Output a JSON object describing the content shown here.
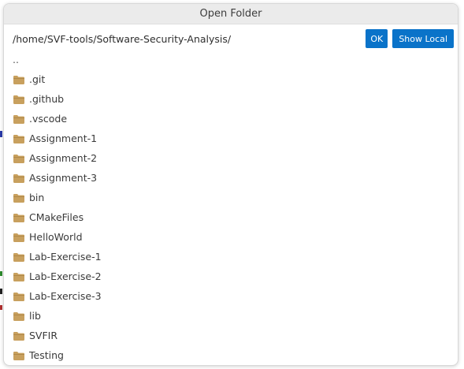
{
  "dialog": {
    "title": "Open Folder",
    "path_value": "/home/SVF-tools/Software-Security-Analysis/",
    "ok_label": "OK",
    "show_local_label": "Show Local"
  },
  "folders": {
    "parent_label": "..",
    "items": [
      {
        "name": ".git"
      },
      {
        "name": ".github"
      },
      {
        "name": ".vscode"
      },
      {
        "name": "Assignment-1"
      },
      {
        "name": "Assignment-2"
      },
      {
        "name": "Assignment-3"
      },
      {
        "name": "bin"
      },
      {
        "name": "CMakeFiles"
      },
      {
        "name": "HelloWorld"
      },
      {
        "name": "Lab-Exercise-1"
      },
      {
        "name": "Lab-Exercise-2"
      },
      {
        "name": "Lab-Exercise-3"
      },
      {
        "name": "lib"
      },
      {
        "name": "SVFIR"
      },
      {
        "name": "Testing"
      }
    ]
  },
  "colors": {
    "accent": "#0a73c9",
    "folder_icon": "#c8a05e"
  }
}
